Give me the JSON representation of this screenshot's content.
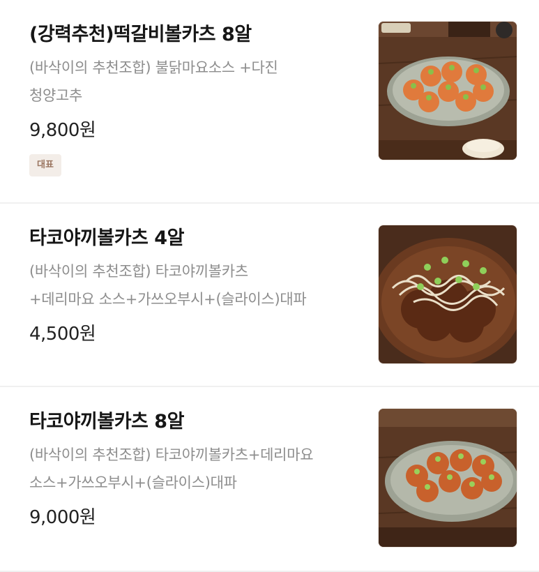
{
  "menu": {
    "items": [
      {
        "name": "(강력추천)떡갈비볼카츠 8알",
        "description_lines": [
          "(바삭이의 추천조합) 불닭마요소스 +다진",
          "청양고추"
        ],
        "price": "9,800원",
        "badge": "대표",
        "image": "takoyaki-plate-photo"
      },
      {
        "name": "타코야끼볼카츠 4알",
        "description_lines": [
          "(바삭이의 추천조합) 타코야끼볼카츠",
          "+데리마요 소스+가쓰오부시+(슬라이스)대파"
        ],
        "price": "4,500원",
        "image": "takoyaki-topped-photo"
      },
      {
        "name": "타코야끼볼카츠 8알",
        "description_lines": [
          "(바삭이의 추천조합) 타코야끼볼카츠+데리마요",
          "소스+가쓰오부시+(슬라이스)대파"
        ],
        "price": "9,000원",
        "image": "takoyaki-plate-photo-2"
      }
    ]
  },
  "colors": {
    "badge_bg": "#f3ede8",
    "badge_text": "#9a7560",
    "desc_text": "#8d8d8d",
    "divider": "#f0f0f0"
  }
}
